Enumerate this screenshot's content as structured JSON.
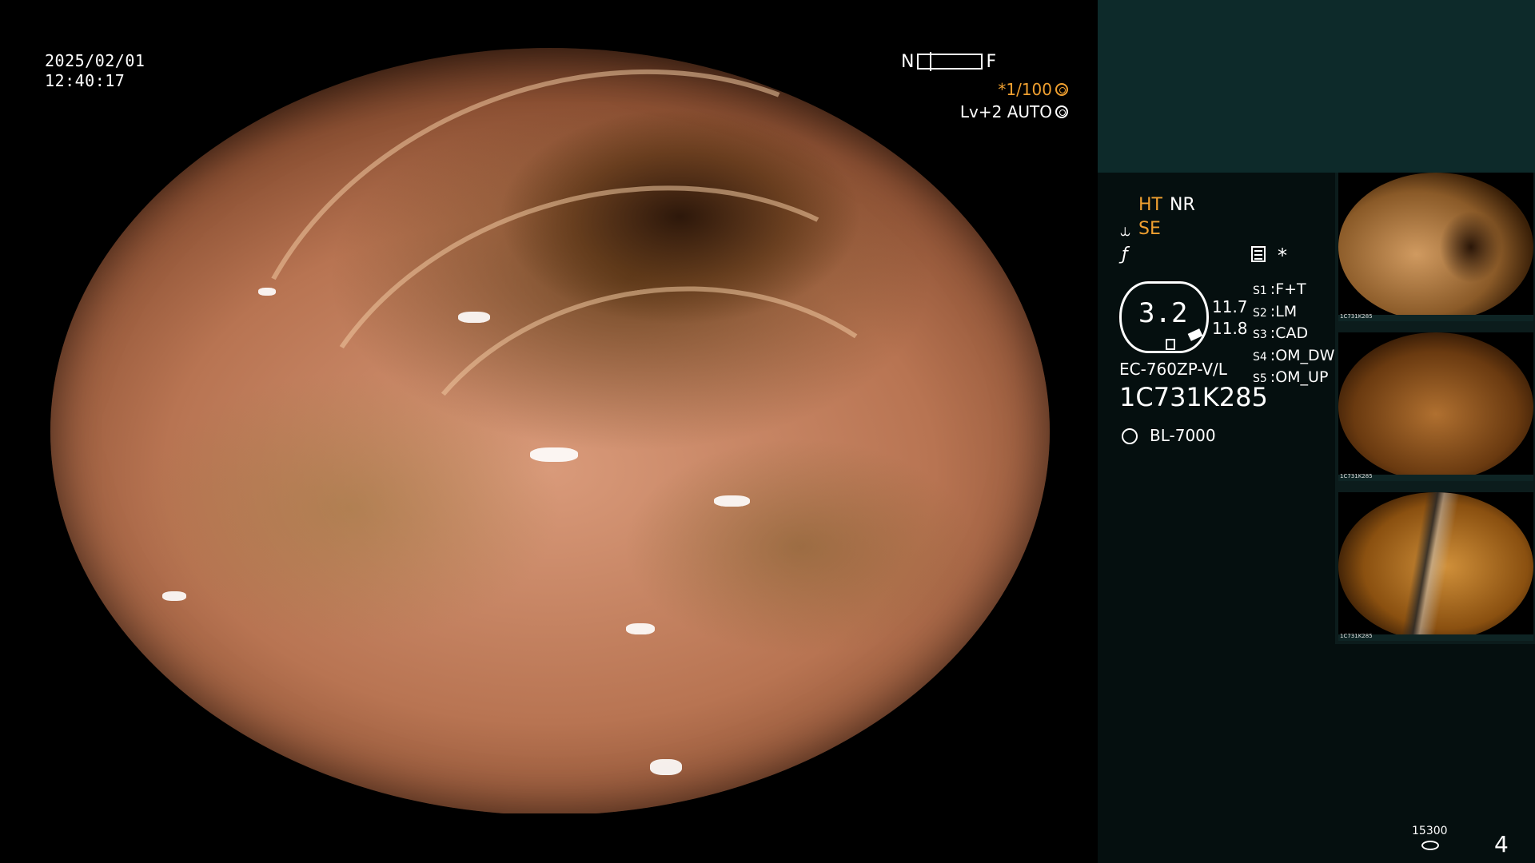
{
  "timestamp": {
    "date": "2025/02/01",
    "time": "12:40:17"
  },
  "gauge": {
    "near_label": "N",
    "far_label": "F"
  },
  "shutter": {
    "value": "*1/100",
    "icon": "aperture-icon"
  },
  "level": {
    "value": "Lv+2 AUTO",
    "icon": "iris-icon"
  },
  "modes": {
    "ht": "HT",
    "nr": "NR",
    "se": "SE",
    "se_icon": "enhance-icon",
    "f_icon": "filter-icon",
    "menu_icon": "memo-icon",
    "star": "*"
  },
  "zoom": {
    "value": "3.2",
    "right_top": "11.7",
    "right_bottom": "11.8"
  },
  "scope_switches": [
    {
      "key": "S1",
      "value": "F+T"
    },
    {
      "key": "S2",
      "value": "LM"
    },
    {
      "key": "S3",
      "value": "CAD"
    },
    {
      "key": "S4",
      "value": "OM_DW"
    },
    {
      "key": "S5",
      "value": "OM_UP"
    }
  ],
  "scope": {
    "model": "EC-760ZP-V/L",
    "serial": "1C731K285"
  },
  "light": {
    "icon": "light-bulb-icon",
    "model": "BL-7000"
  },
  "thumbnails": [
    {
      "caption": "1C731K285"
    },
    {
      "caption": "1C731K285"
    },
    {
      "caption": "1C731K285"
    }
  ],
  "footer": {
    "counter": "15300",
    "counter_icon": "storage-icon",
    "page": "4"
  },
  "colors": {
    "accent": "#f0a030",
    "panel_top": "#0d2a2a",
    "panel_bottom": "#050f0f"
  }
}
